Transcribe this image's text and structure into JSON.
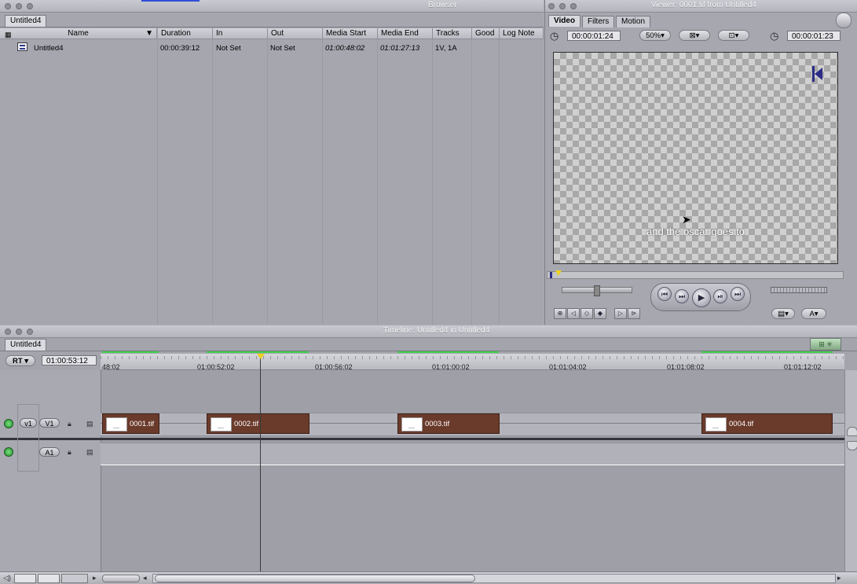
{
  "browser": {
    "window_title": "Browser",
    "tab": "Untitled4",
    "columns": [
      "Name",
      "Duration",
      "In",
      "Out",
      "Media Start",
      "Media End",
      "Tracks",
      "Good",
      "Log Note"
    ],
    "rows": [
      {
        "name": "Untitled4",
        "duration": "00:00:39:12",
        "in": "Not Set",
        "out": "Not Set",
        "media_start": "01:00:48:02",
        "media_end": "01:01:27:13",
        "tracks": "1V, 1A"
      }
    ]
  },
  "viewer": {
    "window_title": "Viewer: 0001.tif from Untitled4",
    "tabs": [
      "Video",
      "Filters",
      "Motion"
    ],
    "active_tab": "Video",
    "duration_timecode": "00:00:01:24",
    "zoom": "50%",
    "current_timecode": "00:00:01:23",
    "overlay_text": "and the oscar goes to"
  },
  "timeline": {
    "window_title": "Timeline: Untitled4 in Untitled4",
    "tab": "Untitled4",
    "rt_label": "RT",
    "timecode": "01:00:53:12",
    "ruler_ticks": [
      "48:02",
      "01:00:52:02",
      "01:00:56:02",
      "01:01:00:02",
      "01:01:04:02",
      "01:01:08:02",
      "01:01:12:02"
    ],
    "tracks": {
      "video": {
        "source": "v1",
        "target": "V1"
      },
      "audio": {
        "target": "A1"
      }
    },
    "clips": [
      {
        "label": "0001.tif"
      },
      {
        "label": "0002.tif"
      },
      {
        "label": "0003.tif"
      },
      {
        "label": "0004.tif"
      }
    ]
  },
  "icons": [
    "clip-sequence-icon",
    "timecode-clock-icon",
    "lock-icon",
    "film-icon",
    "speaker-icon",
    "play-icon"
  ]
}
